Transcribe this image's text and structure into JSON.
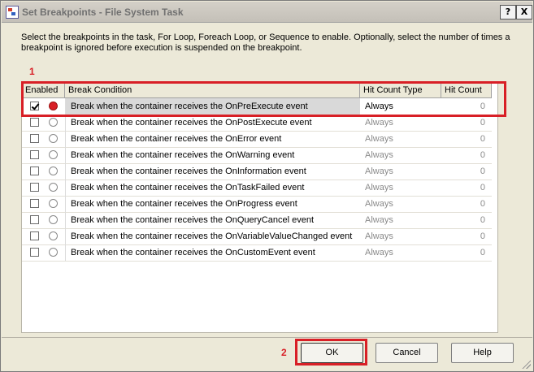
{
  "window": {
    "title": "Set Breakpoints - File System Task",
    "help_button": "?",
    "close_button": "X"
  },
  "instructions": "Select the breakpoints in the task, For Loop, Foreach Loop, or Sequence to enable. Optionally, select the number of times a breakpoint is ignored before execution is suspended on the breakpoint.",
  "annotations": {
    "marker_1": "1",
    "marker_2": "2",
    "highlight_color": "#d81f26"
  },
  "grid": {
    "headers": {
      "enabled": "Enabled",
      "condition": "Break Condition",
      "type": "Hit Count Type",
      "count": "Hit Count"
    },
    "rows": [
      {
        "enabled": true,
        "condition": "Break when the container receives the OnPreExecute event",
        "type": "Always",
        "count": "0"
      },
      {
        "enabled": false,
        "condition": "Break when the container receives the OnPostExecute event",
        "type": "Always",
        "count": "0"
      },
      {
        "enabled": false,
        "condition": "Break when the container receives the OnError event",
        "type": "Always",
        "count": "0"
      },
      {
        "enabled": false,
        "condition": "Break when the container receives the OnWarning event",
        "type": "Always",
        "count": "0"
      },
      {
        "enabled": false,
        "condition": "Break when the container receives the OnInformation event",
        "type": "Always",
        "count": "0"
      },
      {
        "enabled": false,
        "condition": "Break when the container receives the OnTaskFailed event",
        "type": "Always",
        "count": "0"
      },
      {
        "enabled": false,
        "condition": "Break when the container receives the OnProgress event",
        "type": "Always",
        "count": "0"
      },
      {
        "enabled": false,
        "condition": "Break when the container receives the OnQueryCancel event",
        "type": "Always",
        "count": "0"
      },
      {
        "enabled": false,
        "condition": "Break when the container receives the OnVariableValueChanged event",
        "type": "Always",
        "count": "0"
      },
      {
        "enabled": false,
        "condition": "Break when the container receives the OnCustomEvent event",
        "type": "Always",
        "count": "0"
      }
    ]
  },
  "buttons": {
    "ok": "OK",
    "cancel": "Cancel",
    "help": "Help"
  }
}
